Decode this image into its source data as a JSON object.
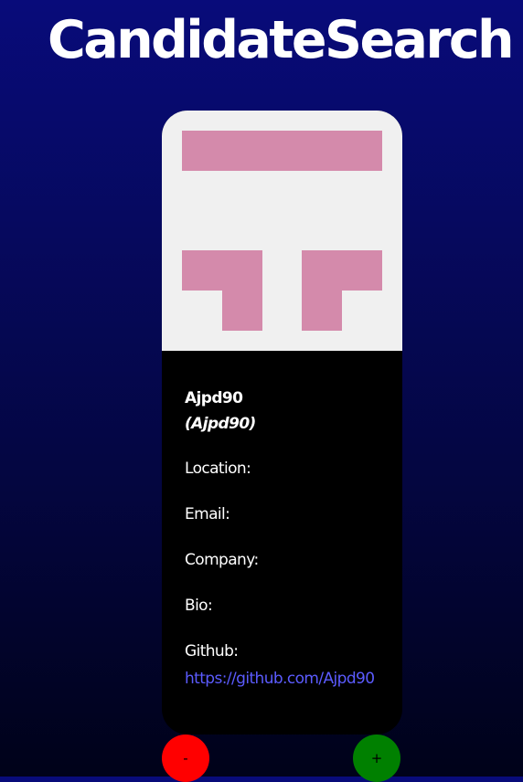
{
  "header": {
    "title": "CandidateSearch"
  },
  "candidate": {
    "name": "Ajpd90",
    "username": "(Ajpd90)",
    "location_label": "Location:",
    "location_value": "",
    "email_label": "Email:",
    "email_value": "",
    "company_label": "Company:",
    "company_value": "",
    "bio_label": "Bio:",
    "bio_value": "",
    "github_label": "Github:",
    "github_url": "https://github.com/Ajpd90",
    "avatar": {
      "type": "identicon",
      "foreground_color": "#d48aab",
      "background_color": "#f0f0f0"
    }
  },
  "actions": {
    "reject_label": "-",
    "accept_label": "+",
    "reject_color": "#ff0000",
    "accept_color": "#008000"
  }
}
